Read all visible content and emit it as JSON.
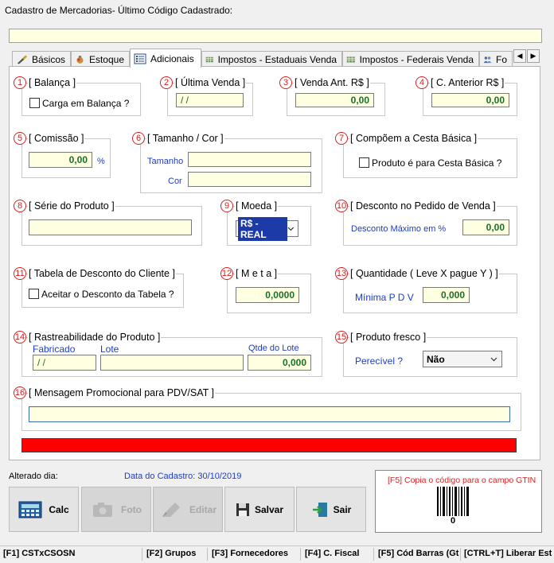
{
  "window": {
    "title": "Cadastro de Mercadorias- Último Código Cadastrado:",
    "top_value": ""
  },
  "tabs": [
    {
      "label": "Básicos",
      "icon": "brush-icon"
    },
    {
      "label": "Estoque",
      "icon": "bag-icon"
    },
    {
      "label": "Adicionais",
      "icon": "list-icon",
      "active": true
    },
    {
      "label": "Impostos - Estaduais Venda",
      "icon": "grid-icon"
    },
    {
      "label": "Impostos - Federais Venda",
      "icon": "grid-icon"
    },
    {
      "label": "Fo",
      "icon": "people-icon"
    }
  ],
  "groups": {
    "balanca": {
      "num": "1",
      "label": "[ Balança ]",
      "check_label": "Carga em Balança ?"
    },
    "ultima_venda": {
      "num": "2",
      "label": "[ Última Venda ]",
      "value": " / /"
    },
    "venda_ant": {
      "num": "3",
      "label": "[ Venda Ant. R$ ]",
      "value": "0,00"
    },
    "c_anterior": {
      "num": "4",
      "label": "[ C. Anterior R$ ]",
      "value": "0,00"
    },
    "comissao": {
      "num": "5",
      "label": "[ Comissão ]",
      "value": "0,00",
      "unit": "%"
    },
    "tamanho_cor": {
      "num": "6",
      "label": "[ Tamanho / Cor ]",
      "tamanho_label": "Tamanho",
      "cor_label": "Cor",
      "tamanho_value": "",
      "cor_value": ""
    },
    "cesta": {
      "num": "7",
      "label": "[ Compõem a Cesta Básica ]",
      "check_label": "Produto é para Cesta Básica ?"
    },
    "serie": {
      "num": "8",
      "label": "[ Série do Produto ]",
      "value": ""
    },
    "moeda": {
      "num": "9",
      "label": "[ Moeda ]",
      "selected": "R$ - REAL"
    },
    "desconto_pedido": {
      "num": "10",
      "label": "[ Desconto no Pedido de Venda ]",
      "sub_label": "Desconto Máximo em %",
      "value": "0,00"
    },
    "tabela_desconto": {
      "num": "11",
      "label": "[ Tabela de Desconto do Cliente ]",
      "check_label": "Aceitar o Desconto da Tabela ?"
    },
    "meta": {
      "num": "12",
      "label": "[ M e t a ]",
      "value": "0,0000"
    },
    "quantidade": {
      "num": "13",
      "label": "[ Quantidade ( Leve X pague Y ) ]",
      "sub_label": "Mínima P D V",
      "value": "0,000"
    },
    "rastreabilidade": {
      "num": "14",
      "label": "[ Rastreabilidade do Produto ]",
      "fabricado_label": "Fabricado",
      "lote_label": "Lote",
      "qtde_label": "Qtde do Lote",
      "fabricado_value": " / /",
      "lote_value": "",
      "qtde_value": "0,000"
    },
    "fresco": {
      "num": "15",
      "label": "[ Produto fresco ]",
      "sub_label": "Perecível ?",
      "selected": "Não"
    },
    "mensagem": {
      "num": "16",
      "label": "[ Mensagem Promocional para PDV/SAT ]",
      "value": ""
    }
  },
  "footer": {
    "alterado_label": "Alterado dia:",
    "cadastro_label": "Data do Cadastro: 30/10/2019",
    "buttons": [
      {
        "label": "Calc",
        "icon": "calculator-icon",
        "enabled": true
      },
      {
        "label": "Foto",
        "icon": "camera-icon",
        "enabled": false
      },
      {
        "label": "Editar",
        "icon": "edit-icon",
        "enabled": false
      },
      {
        "label": "Salvar",
        "icon": "floppy-disk-icon",
        "enabled": true
      },
      {
        "label": "Sair",
        "icon": "exit-door-icon",
        "enabled": true
      }
    ],
    "barcode_hint": "[F5] Copia o código para o campo GTIN",
    "barcode_value": "0"
  },
  "status_bar": [
    "[F1] CSTxCSOSN",
    "[F2] Grupos",
    "[F3] Fornecedores",
    "[F4] C. Fiscal",
    "[F5] Cód Barras (Gt",
    "[CTRL+T] Liberar Est"
  ],
  "colors": {
    "field_bg": "#ffffe1",
    "number_text": "#1a6e2a",
    "accent_blue": "#1e3cc8",
    "badge_red": "#d62020",
    "progress_red": "#ff0000"
  }
}
